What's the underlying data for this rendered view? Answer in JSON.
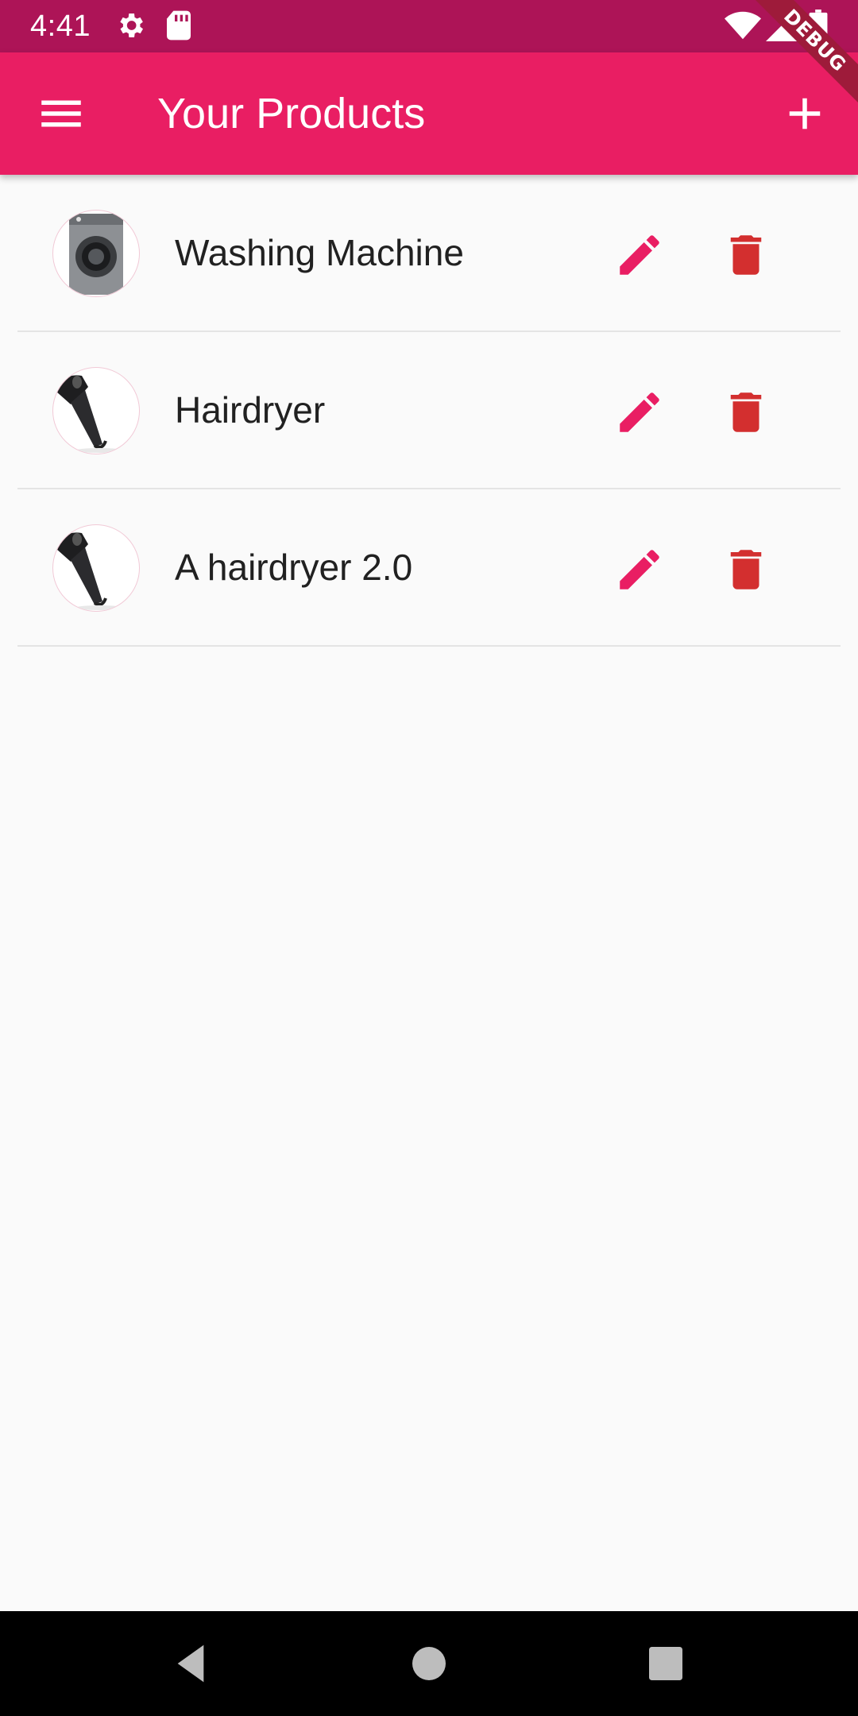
{
  "status_bar": {
    "time": "4:41",
    "icons": [
      "settings-icon",
      "sd-card-icon",
      "wifi-icon",
      "signal-icon",
      "battery-icon"
    ]
  },
  "app_bar": {
    "title": "Your Products",
    "menu_icon": "menu-icon",
    "add_icon": "add-icon",
    "color": "#e91e63"
  },
  "debug_banner": "DEBUG",
  "products": [
    {
      "title": "Washing Machine",
      "image": "washing-machine"
    },
    {
      "title": "Hairdryer",
      "image": "hairdryer"
    },
    {
      "title": "A hairdryer 2.0",
      "image": "hairdryer"
    }
  ],
  "colors": {
    "status_bar": "#ad1457",
    "accent": "#e91e63",
    "delete": "#d32f2f",
    "background": "#fafafa"
  },
  "nav_bar": {
    "buttons": [
      "back-icon",
      "home-icon",
      "recents-icon"
    ]
  }
}
